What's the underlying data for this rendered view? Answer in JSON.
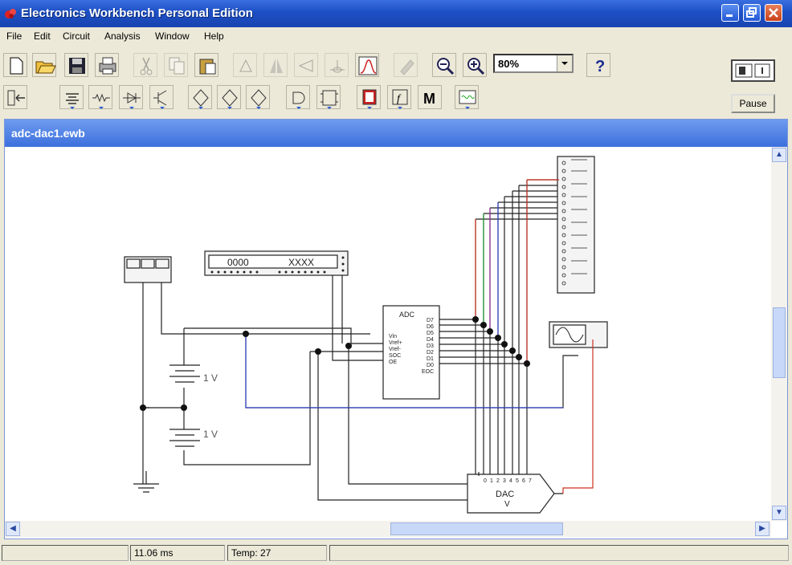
{
  "window": {
    "title": "Electronics Workbench Personal Edition"
  },
  "menu": [
    "File",
    "Edit",
    "Circuit",
    "Analysis",
    "Window",
    "Help"
  ],
  "toolbar": {
    "zoom_value": "80%",
    "help_label": "?",
    "pause_label": "Pause"
  },
  "document": {
    "title": "adc-dac1.ewb"
  },
  "circuit": {
    "word_generator_left": "0000",
    "word_generator_right": "XXXX",
    "battery_top": "1 V",
    "battery_bottom": "1 V",
    "adc_label": "ADC",
    "adc_inputs": [
      "Vin",
      "Vref+",
      "Vref-",
      "SOC",
      "OE"
    ],
    "adc_outputs": [
      "D7",
      "D6",
      "D5",
      "D4",
      "D3",
      "D2",
      "D1",
      "D0",
      "EOC"
    ],
    "dac_label": "DAC",
    "dac_sub": "V",
    "dac_pins": [
      "0",
      "1",
      "2",
      "3",
      "4",
      "5",
      "6",
      "7"
    ],
    "instrument_icons": [
      "multimeter-icon",
      "logic-analyzer-icon",
      "oscilloscope-icon"
    ]
  },
  "status": {
    "time": "11.06 ms",
    "temp": "Temp: 27"
  },
  "colors": {
    "title_bar": "#1d4fc4",
    "doc_title": "#3b6fdc",
    "wire_red": "#cc3322",
    "wire_blue": "#3344cc",
    "wire_green": "#229933",
    "wire_purple": "#993399"
  }
}
